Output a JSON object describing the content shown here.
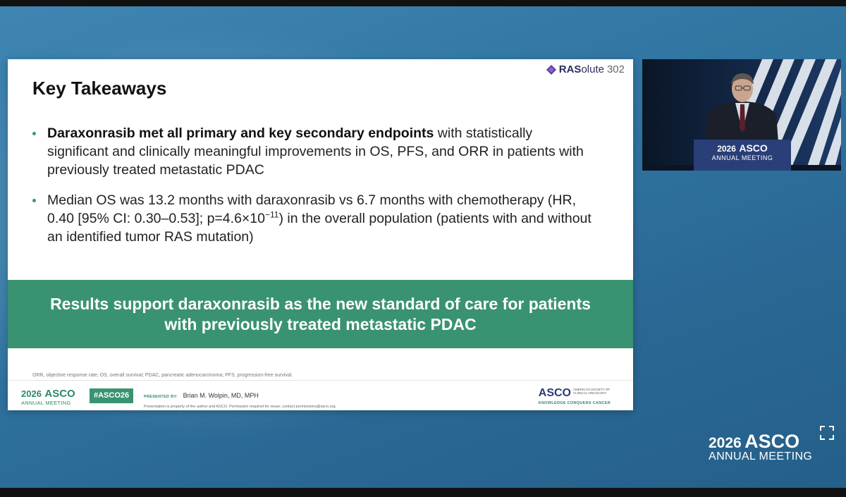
{
  "slide": {
    "brand": {
      "strong": "RAS",
      "rest": "olute",
      "number": "302"
    },
    "title": "Key Takeaways",
    "bullets": [
      {
        "bold": "Daraxonrasib met all primary and key secondary endpoints",
        "text": " with statistically significant and clinically meaningful improvements in OS, PFS, and ORR in patients with previously treated metastatic PDAC"
      },
      {
        "text_before": "Median OS was 13.2 months with daraxonrasib vs 6.7 months with chemotherapy (HR, 0.40 [95% CI: 0.30–0.53]; p=4.6×10",
        "superscript": "−11",
        "text_after": ") in the overall population (patients with and without an identified tumor RAS mutation)"
      }
    ],
    "banner": "Results support daraxonrasib as the new standard of care for patients with previously treated metastatic PDAC",
    "footnote": "ORR, objective response rate; OS, overall survival; PDAC, pancreatic adenocarcinoma; PFS, progression-free survival.",
    "footer": {
      "meeting_year": "2026",
      "meeting_name": "ASCO",
      "meeting_sub": "ANNUAL MEETING",
      "hashtag": "#ASCO26",
      "presented_label": "PRESENTED BY:",
      "presenter": "Brian M. Wolpin, MD, MPH",
      "property_note": "Presentation is property of the author and ASCO. Permission required for reuse; contact permissions@asco.org.",
      "society_abbr": "ASCO",
      "society_name": "AMERICAN SOCIETY OF CLINICAL ONCOLOGY",
      "society_tagline": "KNOWLEDGE CONQUERS CANCER"
    }
  },
  "video": {
    "podium_year": "2026",
    "podium_name": "ASCO",
    "podium_sub": "ANNUAL MEETING"
  },
  "corner": {
    "year": "2026",
    "name": "ASCO",
    "sub": "ANNUAL MEETING",
    "icon": "fullscreen-icon"
  },
  "colors": {
    "accent_green": "#3a9370",
    "background_blue": "#2f739f"
  }
}
